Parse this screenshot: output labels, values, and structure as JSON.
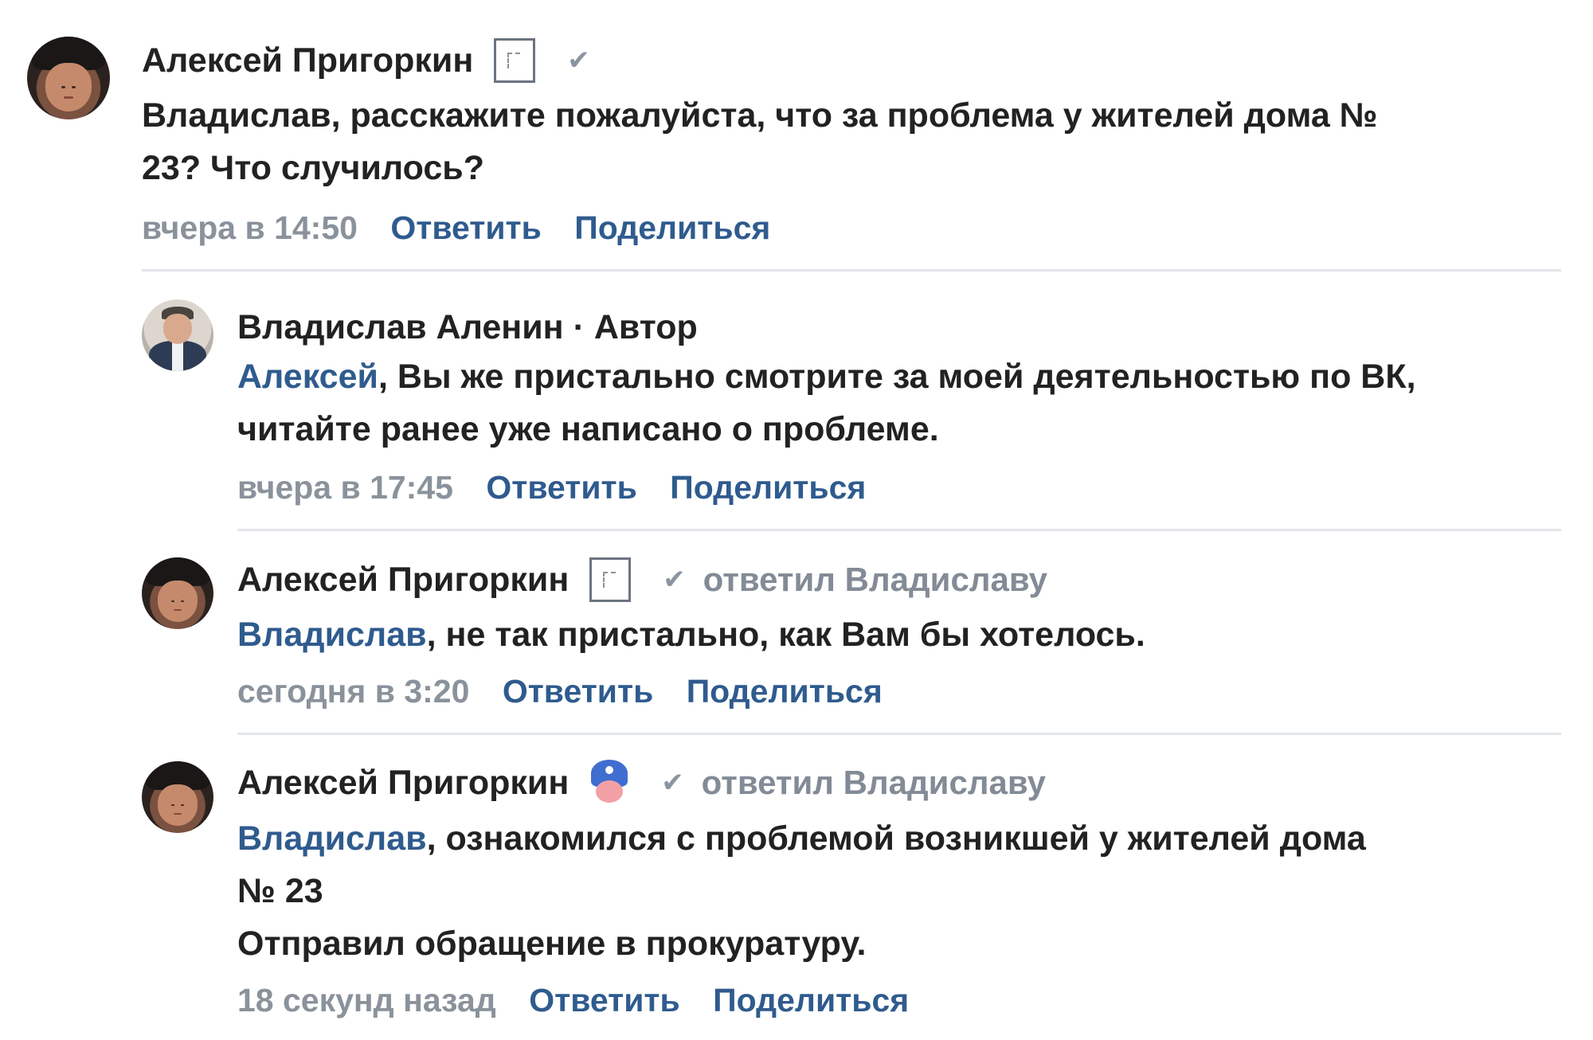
{
  "comments": [
    {
      "author": "Алексей Пригоркин",
      "avatar_icon": "user-avatar",
      "badge": "square-badge-icon",
      "replied_to": "",
      "mention": "",
      "lines": [
        "Владислав, расскажите пожалуйста, что за проблема у жителей дома №",
        "23? Что случилось?"
      ],
      "time": "вчера в 14:50",
      "reply_label": "Ответить",
      "share_label": "Поделиться"
    },
    {
      "author": "Владислав Аленин · Автор",
      "avatar_icon": "user-avatar",
      "badge": "",
      "replied_to": "",
      "mention": "Алексей",
      "first_line_rest": ", Вы же пристально смотрите за моей деятельностью по ВК,",
      "lines": [
        "читайте ранее уже написано о проблеме."
      ],
      "time": "вчера в 17:45",
      "reply_label": "Ответить",
      "share_label": "Поделиться"
    },
    {
      "author": "Алексей Пригоркин",
      "avatar_icon": "user-avatar",
      "badge": "square-badge-icon",
      "replied_to": "ответил Владиславу",
      "mention": "Владислав",
      "first_line_rest": ", не так пристально, как Вам бы хотелось.",
      "lines": [],
      "time": "сегодня в 3:20",
      "reply_label": "Ответить",
      "share_label": "Поделиться"
    },
    {
      "author": "Алексей Пригоркин",
      "avatar_icon": "user-avatar",
      "badge": "mask-badge-icon",
      "replied_to": "ответил Владиславу",
      "mention": "Владислав",
      "first_line_rest": ", ознакомился с проблемой возникшей у жителей дома",
      "lines": [
        "№ 23",
        "Отправил обращение в прокуратуру."
      ],
      "time": "18 секунд назад",
      "reply_label": "Ответить",
      "share_label": "Поделиться"
    }
  ],
  "colors": {
    "link": "#2f5b8e",
    "meta": "#8a929b",
    "separator": "#e3e6ea"
  }
}
